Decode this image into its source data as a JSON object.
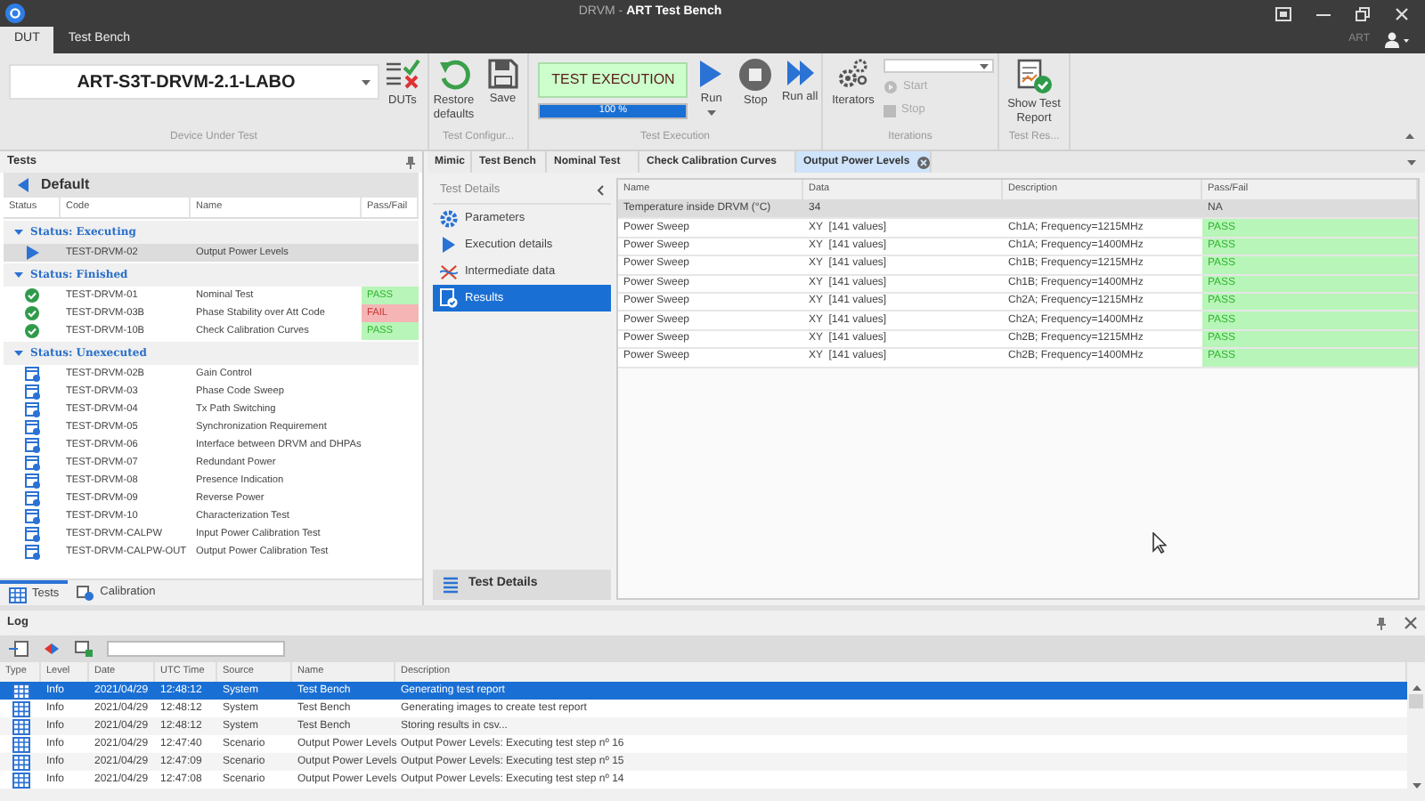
{
  "window": {
    "title": "DRVM - **ART Test Bench**"
  },
  "ribbon_tabs": [
    {
      "label": "DUT",
      "selected": true
    },
    {
      "label": "Test Bench",
      "selected": false
    }
  ],
  "user": {
    "name": "ART"
  },
  "ribbon": {
    "dut_combo": {
      "value": "ART-S3T-DRVM-2.1-LABO"
    },
    "groups": [
      {
        "label": "Device Under Test",
        "buttons": [
          {
            "label": "DUTs"
          }
        ]
      },
      {
        "label": "Test Configur...",
        "buttons": [
          {
            "label": "Restore defaults"
          },
          {
            "label": "Save"
          }
        ]
      },
      {
        "label": "Test Execution",
        "status": "TEST EXECUTION",
        "progress": {
          "level": 1,
          "reading": "100 %"
        },
        "buttons": [
          {
            "label": "Run"
          },
          {
            "label": "Stop"
          },
          {
            "label": "Run all"
          }
        ]
      },
      {
        "label": "Iterations",
        "buttons": [
          {
            "label": "Iterators"
          }
        ],
        "actions": [
          {
            "label": "Start",
            "disabled": true
          },
          {
            "label": "Stop",
            "disabled": true
          }
        ]
      },
      {
        "label": "Test Res...",
        "buttons": [
          {
            "label": "Show Test Report"
          }
        ]
      }
    ]
  },
  "tests_panel": {
    "title": "Tests",
    "breadcrumb": "Default",
    "columns": [
      "Status",
      "Code",
      "Name",
      "Pass/Fail"
    ],
    "groups": [
      {
        "label": "Status: Executing",
        "expanded": true,
        "rows": [
          {
            "kind": "executing",
            "code": "TEST-DRVM-02",
            "name": "Output Power Levels",
            "selected": true
          }
        ]
      },
      {
        "label": "Status: Finished",
        "expanded": true,
        "rows": [
          {
            "kind": "finished",
            "code": "TEST-DRVM-01",
            "name": "Nominal Test",
            "result": {
              "text": "PASS",
              "kind": "pass"
            },
            "selected": false
          },
          {
            "kind": "finished",
            "code": "TEST-DRVM-03B",
            "name": "Phase Stability over Att Code",
            "result": {
              "text": "FAIL",
              "kind": "fail"
            },
            "selected": false
          },
          {
            "kind": "finished",
            "code": "TEST-DRVM-10B",
            "name": "Check Calibration Curves",
            "result": {
              "text": "PASS",
              "kind": "pass"
            },
            "selected": false
          }
        ]
      },
      {
        "label": "Status: Unexecuted",
        "expanded": true,
        "rows": [
          {
            "kind": "unexecuted",
            "code": "TEST-DRVM-02B",
            "name": "Gain Control",
            "selected": false
          },
          {
            "kind": "unexecuted",
            "code": "TEST-DRVM-03",
            "name": "Phase Code Sweep",
            "selected": false
          },
          {
            "kind": "unexecuted",
            "code": "TEST-DRVM-04",
            "name": "Tx Path Switching",
            "selected": false
          },
          {
            "kind": "unexecuted",
            "code": "TEST-DRVM-05",
            "name": "Synchronization Requirement",
            "selected": false
          },
          {
            "kind": "unexecuted",
            "code": "TEST-DRVM-06",
            "name": "Interface between DRVM and DHPAs",
            "selected": false
          },
          {
            "kind": "unexecuted",
            "code": "TEST-DRVM-07",
            "name": "Redundant Power",
            "selected": false
          },
          {
            "kind": "unexecuted",
            "code": "TEST-DRVM-08",
            "name": "Presence Indication",
            "selected": false
          },
          {
            "kind": "unexecuted",
            "code": "TEST-DRVM-09",
            "name": "Reverse Power",
            "selected": false
          },
          {
            "kind": "unexecuted",
            "code": "TEST-DRVM-10",
            "name": "Characterization Test",
            "selected": false
          },
          {
            "kind": "unexecuted",
            "code": "TEST-DRVM-CALPW",
            "name": "Input Power Calibration Test",
            "selected": false
          },
          {
            "kind": "unexecuted",
            "code": "TEST-DRVM-CALPW-OUT",
            "name": "Output Power Calibration Test",
            "selected": false
          }
        ]
      }
    ],
    "bottom_tabs": [
      {
        "label": "Tests",
        "selected": true
      },
      {
        "label": "Calibration",
        "selected": false
      }
    ]
  },
  "document_tabs": [
    {
      "label": "Mimic",
      "selected": false
    },
    {
      "label": "Test Bench",
      "selected": false
    },
    {
      "label": "Nominal Test",
      "selected": false
    },
    {
      "label": "Check Calibration Curves",
      "selected": false
    },
    {
      "label": "Output Power Levels",
      "selected": true
    }
  ],
  "test_details": {
    "title": "Test Details",
    "items": [
      {
        "label": "Parameters",
        "selected": false
      },
      {
        "label": "Execution details",
        "selected": false
      },
      {
        "label": "Intermediate data",
        "selected": false
      },
      {
        "label": "Results",
        "selected": true
      }
    ],
    "footer": "Test Details"
  },
  "results": {
    "columns": [
      "Name",
      "Data",
      "Description",
      "Pass/Fail"
    ],
    "rows": [
      {
        "name": "Temperature inside DRVM (°C)",
        "data": "34",
        "result": {
          "text": "NA",
          "kind": "none"
        },
        "selected": true
      },
      {
        "name": "Power Sweep",
        "data": "XY  [141 values]",
        "description": "Ch1A; Frequency=1215MHz",
        "result": {
          "text": "PASS",
          "kind": "pass"
        },
        "selected": false
      },
      {
        "name": "Power Sweep",
        "data": "XY  [141 values]",
        "description": "Ch1A; Frequency=1400MHz",
        "result": {
          "text": "PASS",
          "kind": "pass"
        },
        "selected": false
      },
      {
        "name": "Power Sweep",
        "data": "XY  [141 values]",
        "description": "Ch1B; Frequency=1215MHz",
        "result": {
          "text": "PASS",
          "kind": "pass"
        },
        "selected": false
      },
      {
        "name": "Power Sweep",
        "data": "XY  [141 values]",
        "description": "Ch1B; Frequency=1400MHz",
        "result": {
          "text": "PASS",
          "kind": "pass"
        },
        "selected": false
      },
      {
        "name": "Power Sweep",
        "data": "XY  [141 values]",
        "description": "Ch2A; Frequency=1215MHz",
        "result": {
          "text": "PASS",
          "kind": "pass"
        },
        "selected": false
      },
      {
        "name": "Power Sweep",
        "data": "XY  [141 values]",
        "description": "Ch2A; Frequency=1400MHz",
        "result": {
          "text": "PASS",
          "kind": "pass"
        },
        "selected": false
      },
      {
        "name": "Power Sweep",
        "data": "XY  [141 values]",
        "description": "Ch2B; Frequency=1215MHz",
        "result": {
          "text": "PASS",
          "kind": "pass"
        },
        "selected": false
      },
      {
        "name": "Power Sweep",
        "data": "XY  [141 values]",
        "description": "Ch2B; Frequency=1400MHz",
        "result": {
          "text": "PASS",
          "kind": "pass"
        },
        "selected": false
      }
    ]
  },
  "log": {
    "title": "Log",
    "columns": [
      "Type",
      "Level",
      "Date",
      "UTC Time",
      "Source",
      "Name",
      "Description"
    ],
    "rows": [
      {
        "level": "Info",
        "date": "2021/04/29",
        "time": "12:48:12",
        "source": "System",
        "name": "Test Bench",
        "description": "Generating test report",
        "selected": true
      },
      {
        "level": "Info",
        "date": "2021/04/29",
        "time": "12:48:12",
        "source": "System",
        "name": "Test Bench",
        "description": "Generating images to create test report",
        "selected": false
      },
      {
        "level": "Info",
        "date": "2021/04/29",
        "time": "12:48:12",
        "source": "System",
        "name": "Test Bench",
        "description": "Storing results in csv...",
        "selected": false
      },
      {
        "level": "Info",
        "date": "2021/04/29",
        "time": "12:47:40",
        "source": "Scenario",
        "name": "Output Power Levels",
        "description": "Output Power Levels: Executing test step nº 16",
        "selected": false
      },
      {
        "level": "Info",
        "date": "2021/04/29",
        "time": "12:47:09",
        "source": "Scenario",
        "name": "Output Power Levels",
        "description": "Output Power Levels: Executing test step nº 15",
        "selected": false
      },
      {
        "level": "Info",
        "date": "2021/04/29",
        "time": "12:47:08",
        "source": "Scenario",
        "name": "Output Power Levels",
        "description": "Output Power Levels: Executing test step nº 14",
        "selected": false
      }
    ]
  }
}
